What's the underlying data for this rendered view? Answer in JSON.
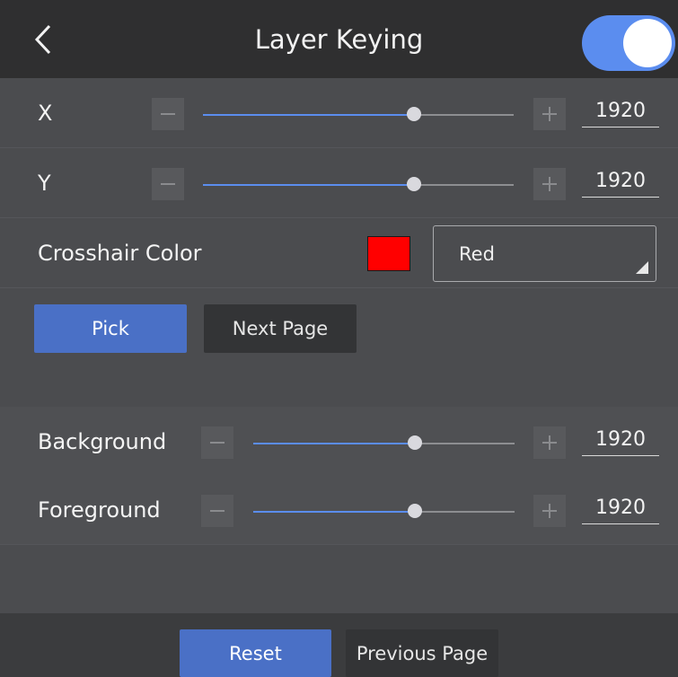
{
  "header": {
    "title": "Layer Keying",
    "back_icon": "chevron-left-icon",
    "toggle_on": true,
    "toggle_color": "#5b8def"
  },
  "rows": {
    "x": {
      "label": "X",
      "value": "1920",
      "level": 0.68
    },
    "y": {
      "label": "Y",
      "value": "1920",
      "level": 0.68
    },
    "crosshair": {
      "label": "Crosshair Color",
      "swatch_color": "#ff0000",
      "selected": "Red"
    },
    "background": {
      "label": "Background",
      "value": "1920",
      "level": 0.62
    },
    "foreground": {
      "label": "Foreground",
      "value": "1920",
      "level": 0.62
    }
  },
  "buttons": {
    "pick": "Pick",
    "next_page": "Next Page",
    "reset": "Reset",
    "previous_page": "Previous Page"
  },
  "colors": {
    "accent": "#5b8def",
    "primary_button": "#4a70c6"
  }
}
